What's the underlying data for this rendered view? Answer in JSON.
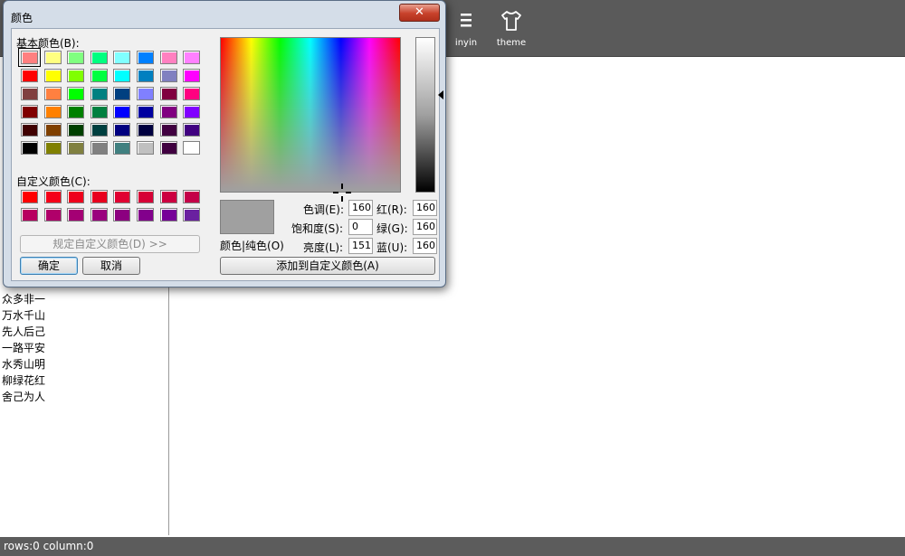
{
  "toolbar": {
    "items": [
      {
        "label": "inyin",
        "icon": "list-icon"
      },
      {
        "label": "theme",
        "icon": "shirt-icon"
      }
    ]
  },
  "sidebar": {
    "items": [
      "众多非一",
      "万水千山",
      "先人后己",
      "一路平安",
      "水秀山明",
      "柳绿花红",
      "舍己为人"
    ]
  },
  "status": {
    "text": "rows:0 column:0"
  },
  "dialog": {
    "title": "颜色",
    "close_label": "✕",
    "basic_colors_label": "基本颜色(B):",
    "custom_colors_label": "自定义颜色(C):",
    "define_custom_label": "规定自定义颜色(D) >>",
    "ok_label": "确定",
    "cancel_label": "取消",
    "color_solid_label": "颜色|纯色(O)",
    "add_custom_label": "添加到自定义颜色(A)",
    "hue_label": "色调(E):",
    "sat_label": "饱和度(S):",
    "lum_label": "亮度(L):",
    "red_label": "红(R):",
    "green_label": "绿(G):",
    "blue_label": "蓝(U):",
    "hue": "160",
    "sat": "0",
    "lum": "151",
    "red": "160",
    "green": "160",
    "blue": "160",
    "preview_color": "#a0a0a0",
    "basic_colors": [
      "#ff8080",
      "#ffff80",
      "#80ff80",
      "#00ff80",
      "#80ffff",
      "#0080ff",
      "#ff80c0",
      "#ff80ff",
      "#ff0000",
      "#ffff00",
      "#80ff00",
      "#00ff40",
      "#00ffff",
      "#0080c0",
      "#8080c0",
      "#ff00ff",
      "#804040",
      "#ff8040",
      "#00ff00",
      "#008080",
      "#004080",
      "#8080ff",
      "#800040",
      "#ff0080",
      "#800000",
      "#ff8000",
      "#008000",
      "#008040",
      "#0000ff",
      "#0000a0",
      "#800080",
      "#8000ff",
      "#400000",
      "#804000",
      "#004000",
      "#004040",
      "#000080",
      "#000040",
      "#400040",
      "#400080",
      "#000000",
      "#808000",
      "#808040",
      "#808080",
      "#408080",
      "#c0c0c0",
      "#400040",
      "#ffffff"
    ],
    "custom_colors": [
      "#ff0000",
      "#f50018",
      "#ee001c",
      "#e8001e",
      "#e00032",
      "#d60036",
      "#cc0040",
      "#c40048",
      "#b80060",
      "#b0006a",
      "#a40074",
      "#9a007e",
      "#8c0080",
      "#82008c",
      "#760098",
      "#6a20a0"
    ]
  }
}
